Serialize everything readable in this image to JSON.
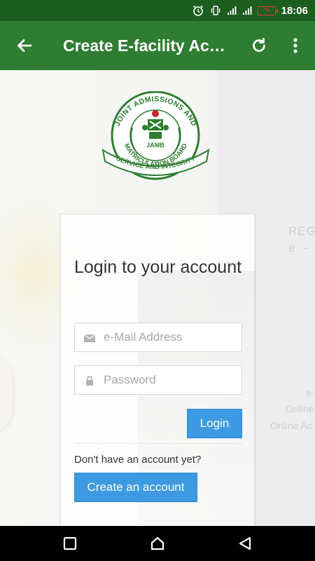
{
  "status_bar": {
    "time": "18:06",
    "battery_level": "7%",
    "icons": [
      "alarm-icon",
      "vibrate-icon",
      "signal-icon",
      "signal-icon",
      "battery-icon"
    ]
  },
  "app_bar": {
    "title": "Create E-facility Account",
    "back_icon": "arrow-left-icon",
    "refresh_icon": "refresh-icon",
    "menu_icon": "more-vert-icon",
    "color": "#2e7d32",
    "status_color": "#1b5e20"
  },
  "logo": {
    "top_text": "JOINT ADMISSIONS AND",
    "bottom_text": "MATRICULATION BOARD",
    "center_text": "JAMB",
    "ribbon_text": "SERVICE AND INTEGRITY"
  },
  "background_text": {
    "line1": "REG",
    "line2": "e - P",
    "line3": "e-",
    "line4": "Online",
    "line5": "Online Ac"
  },
  "login_card": {
    "heading": "Login to your account",
    "email": {
      "placeholder": "e-Mail Address",
      "value": "",
      "icon": "envelope-icon"
    },
    "password": {
      "placeholder": "Password",
      "value": "",
      "icon": "lock-icon"
    },
    "login_label": "Login",
    "no_account_text": "Don't have an account yet?",
    "create_label": "Create an account",
    "button_color": "#3d9ae2"
  },
  "nav_bar": {
    "icons": [
      "recent-apps-icon",
      "home-icon",
      "back-triangle-icon"
    ]
  }
}
